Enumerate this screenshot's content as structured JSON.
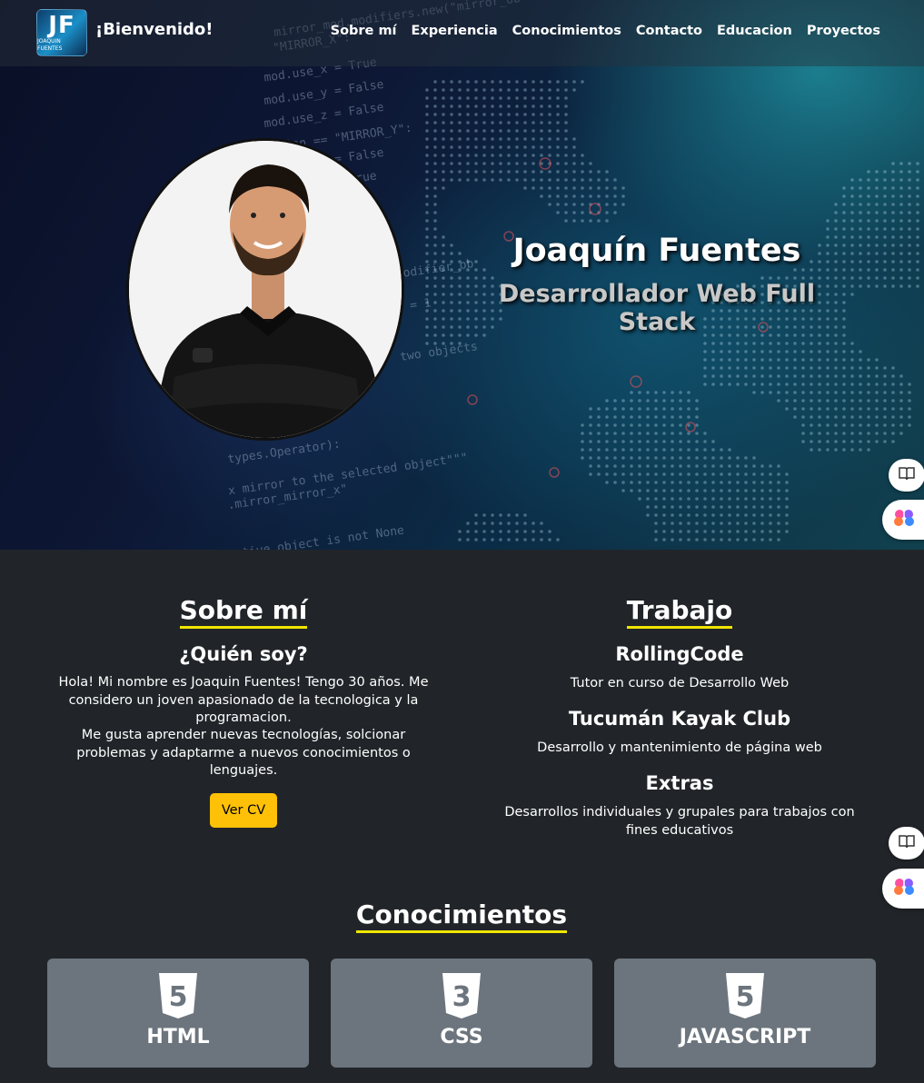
{
  "nav": {
    "logo_text": "JF",
    "logo_subtext": "JOAQUIN FUENTES",
    "brand": "¡Bienvenido!",
    "links": [
      "Sobre mí",
      "Experiencia",
      "Conocimientos",
      "Contacto",
      "Educacion",
      "Proyectos"
    ]
  },
  "hero": {
    "name": "Joaquín Fuentes",
    "role": "Desarrollador Web Full Stack"
  },
  "about": {
    "title": "Sobre mí",
    "subtitle": "¿Quién soy?",
    "paragraph1": "Hola! Mi nombre es Joaquin Fuentes! Tengo 30 años. Me considero un joven apasionado de la tecnologica y la programacion.",
    "paragraph2": "Me gusta aprender nuevas tecnologías, solcionar problemas y adaptarme a nuevos conocimientos o lenguajes.",
    "cv_button": "Ver CV"
  },
  "work": {
    "title": "Trabajo",
    "items": [
      {
        "head": "RollingCode",
        "text": "Tutor en curso de Desarrollo Web"
      },
      {
        "head": "Tucumán Kayak Club",
        "text": "Desarrollo y mantenimiento de página web"
      },
      {
        "head": "Extras",
        "text": "Desarrollos individuales y grupales para trabajos con fines educativos"
      }
    ]
  },
  "skills": {
    "title": "Conocimientos",
    "cards": [
      {
        "label": "HTML",
        "icon": "html5-icon",
        "number": "5"
      },
      {
        "label": "CSS",
        "icon": "css3-icon",
        "number": "3"
      },
      {
        "label": "JAVASCRIPT",
        "icon": "js-icon",
        "number": "5"
      }
    ]
  },
  "colors": {
    "accent_yellow": "#ffc107",
    "underline_yellow": "#f0e600",
    "section_bg": "#212529",
    "card_bg": "#6c757d"
  }
}
